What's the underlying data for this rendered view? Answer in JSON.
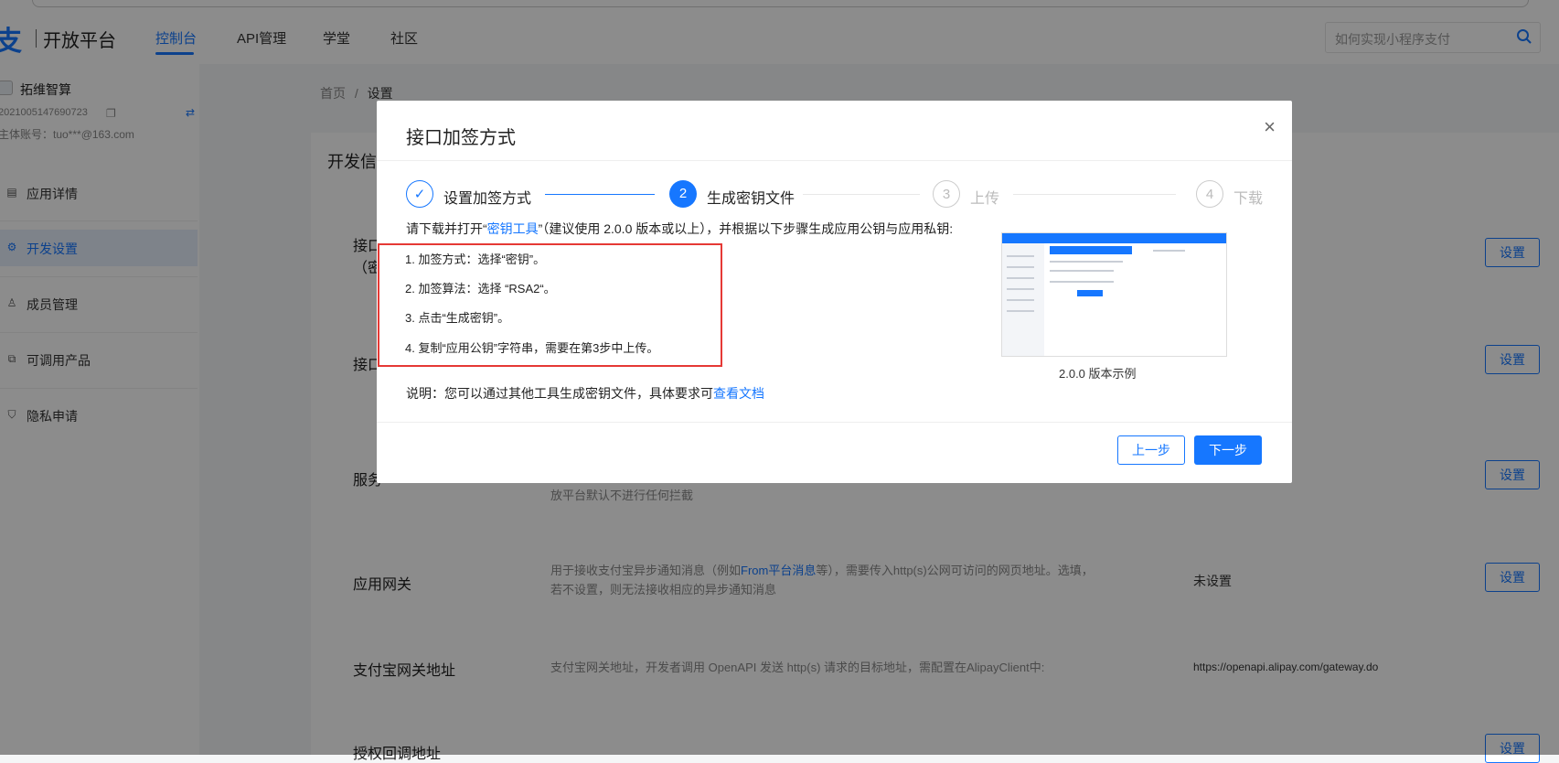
{
  "header": {
    "logo_mark": "支",
    "logo_text": "开放平台",
    "nav": [
      "控制台",
      "API管理",
      "学堂",
      "社区"
    ],
    "search_placeholder": "如何实现小程序支付"
  },
  "sidebar": {
    "app_name": "拓维智算",
    "app_id": "2021005147690723",
    "account": "主体账号：tuo***@163.com",
    "items": [
      {
        "label": "应用详情",
        "icon": "app-detail-icon"
      },
      {
        "label": "开发设置",
        "icon": "dev-settings-icon"
      },
      {
        "label": "成员管理",
        "icon": "members-icon"
      },
      {
        "label": "可调用产品",
        "icon": "products-icon"
      },
      {
        "label": "隐私申请",
        "icon": "privacy-icon"
      }
    ]
  },
  "breadcrumb": {
    "home": "首页",
    "sep": "/",
    "current": "设置"
  },
  "card": {
    "title_partial": "开发信",
    "rows": {
      "sign_label": "接口",
      "sign_sub": "（密",
      "enc_label": "接口",
      "service_label": "服务",
      "service_desc": "放平台默认不进行任何拦截",
      "gateway_label": "应用网关",
      "gateway_desc_1": "用于接收支付宝异步通知消息（例如",
      "gateway_desc_link": "From平台消息",
      "gateway_desc_2": "等），需要传入http(s)公网可访问的网页地址。选填，",
      "gateway_desc_3": "若不设置，则无法接收相应的异步通知消息",
      "gateway_value": "未设置",
      "alipay_gw_label": "支付宝网关地址",
      "alipay_gw_desc": "支付宝网关地址，开发者调用 OpenAPI 发送 http(s) 请求的目标地址，需配置在AlipayClient中:",
      "alipay_gw_value": "https://openapi.alipay.com/gateway.do",
      "callback_label": "授权回调地址"
    },
    "set_button": "设置"
  },
  "modal": {
    "title": "接口加签方式",
    "close": "×",
    "steps": [
      {
        "num": "✓",
        "label": "设置加签方式"
      },
      {
        "num": "2",
        "label": "生成密钥文件"
      },
      {
        "num": "3",
        "label": "上传"
      },
      {
        "num": "4",
        "label": "下载"
      }
    ],
    "intro_1": "请下载并打开“",
    "intro_link": "密钥工具",
    "intro_2": "”（建议使用 2.0.0 版本或以上），并根据以下步骤生成应用公钥与应用私钥:",
    "instructions": [
      "1. 加签方式：选择“密钥”。",
      "2. 加签算法：选择 “RSA2“。",
      "3. 点击“生成密钥”。",
      "4. 复制“应用公钥”字符串，需要在第3步中上传。"
    ],
    "note_1": "说明：您可以通过其他工具生成密钥文件，具体要求可",
    "note_link": "查看文档",
    "example_caption": "2.0.0 版本示例",
    "prev": "上一步",
    "next": "下一步"
  }
}
